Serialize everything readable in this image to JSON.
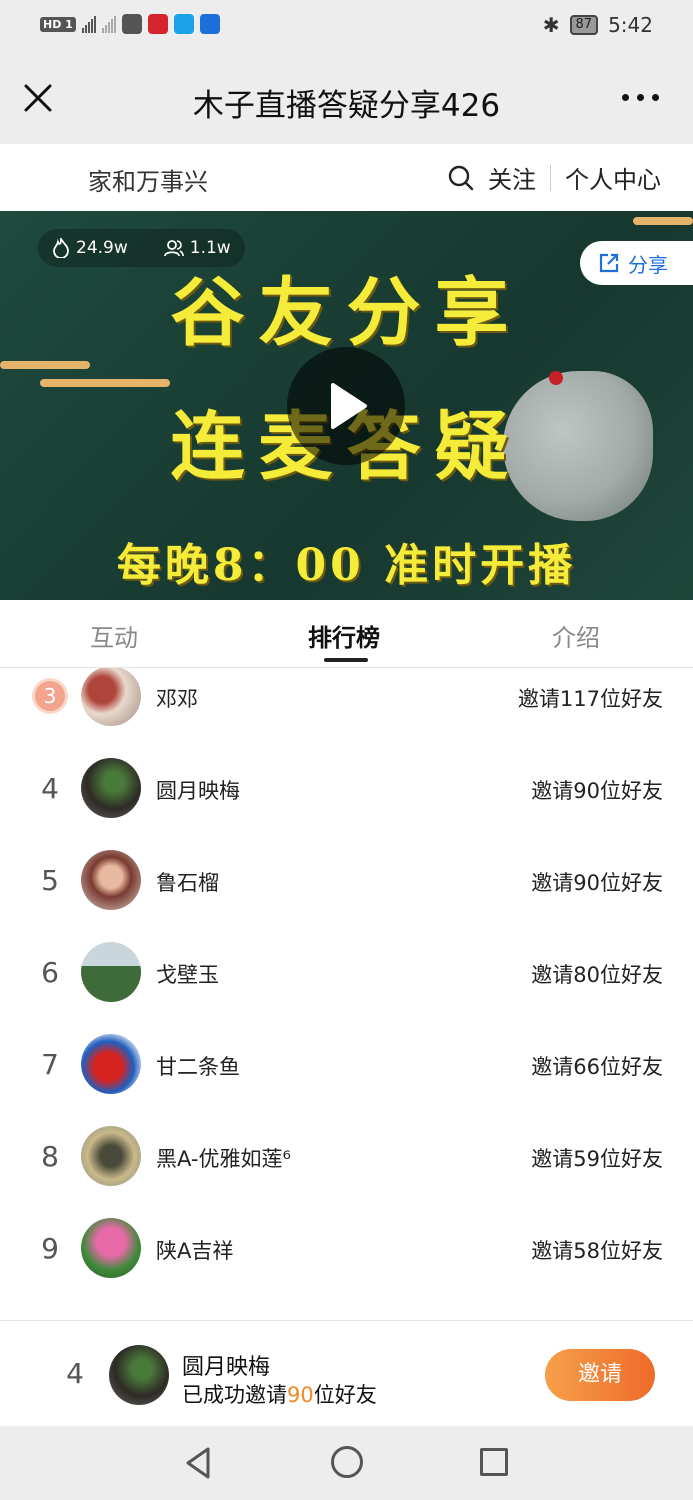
{
  "status_bar": {
    "network": "HD 1",
    "time": "5:42",
    "battery": "87"
  },
  "header": {
    "title": "木子直播答疑分享426"
  },
  "channel": {
    "name": "家和万事兴",
    "follow_label": "关注",
    "profile_label": "个人中心"
  },
  "banner": {
    "heat": "24.9w",
    "viewers": "1.1w",
    "share_label": "分享",
    "line1": "谷友分享",
    "line2": "连麦答疑",
    "line3": "每晚8：00 准时开播"
  },
  "tabs": [
    {
      "label": "互动"
    },
    {
      "label": "排行榜"
    },
    {
      "label": "介绍"
    }
  ],
  "ranking": [
    {
      "rank": "3",
      "name": "邓邓",
      "invite": "邀请117位好友"
    },
    {
      "rank": "4",
      "name": "圆月映梅",
      "invite": "邀请90位好友"
    },
    {
      "rank": "5",
      "name": "鲁石榴",
      "invite": "邀请90位好友"
    },
    {
      "rank": "6",
      "name": "戈壁玉",
      "invite": "邀请80位好友"
    },
    {
      "rank": "7",
      "name": "甘二条鱼",
      "invite": "邀请66位好友"
    },
    {
      "rank": "8",
      "name": "黑A-优雅如莲⁶",
      "invite": "邀请59位好友"
    },
    {
      "rank": "9",
      "name": "陕A吉祥",
      "invite": "邀请58位好友"
    }
  ],
  "my_rank": {
    "rank": "4",
    "name": "圆月映梅",
    "invite_prefix": "已成功邀请",
    "invite_count": "90",
    "invite_suffix": "位好友",
    "button_label": "邀请"
  },
  "colors": {
    "accent_orange": "#f08a24",
    "share_blue": "#1e6fd9",
    "banner_text": "#f5ec3a"
  }
}
